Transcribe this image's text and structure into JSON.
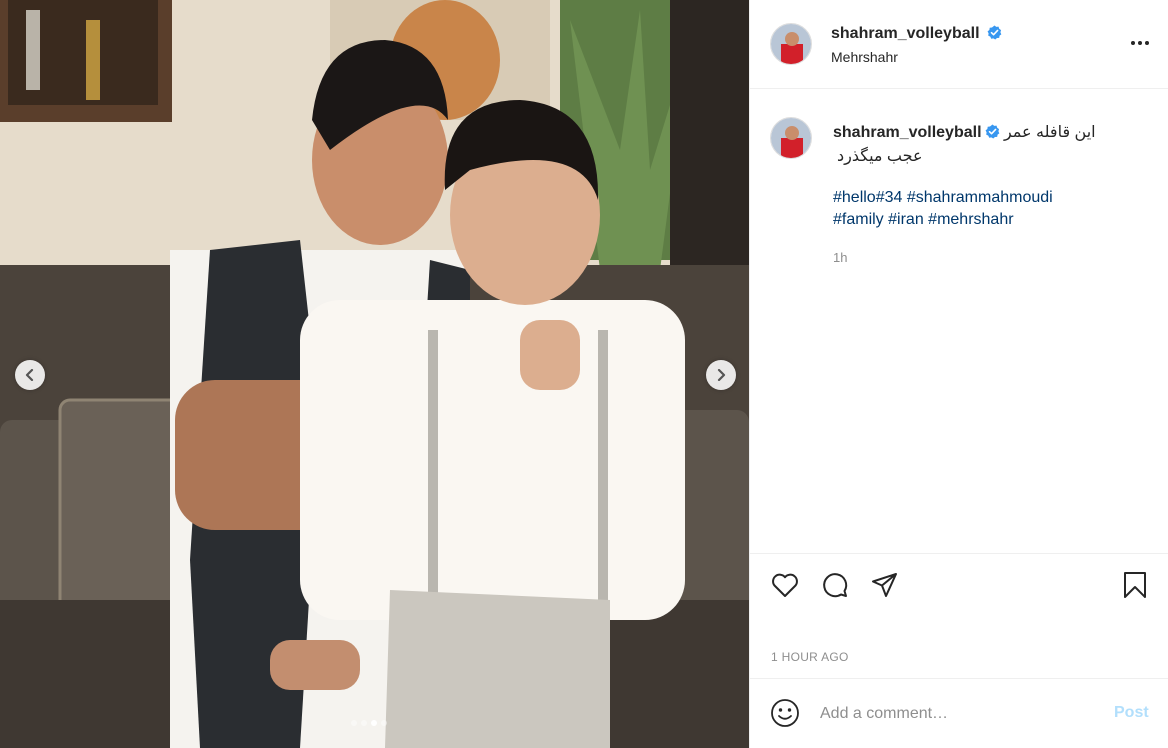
{
  "post": {
    "username": "shahram_volleyball",
    "location": "Mehrshahr",
    "caption_text": "این قافله عمر عجب میگذرد",
    "hashtags": [
      "#hello",
      "#34",
      " #shahrammahmoudi",
      "#family",
      " #iran",
      " #mehrshahr"
    ],
    "relative_time": "1h",
    "timestamp": "1 HOUR AGO"
  },
  "comment": {
    "placeholder": "Add a comment…",
    "post_label": "Post"
  },
  "carousel": {
    "slide_count": 4,
    "active_index": 2
  },
  "colors": {
    "verified": "#3897f0",
    "hashtag": "#00376b",
    "post_disabled": "#b2dffc",
    "muted": "#8e8e8e"
  },
  "icons": {
    "like": "heart-icon",
    "comment": "comment-icon",
    "share": "paper-plane-icon",
    "save": "bookmark-icon",
    "emoji": "smiley-icon",
    "more": "more-options-icon",
    "prev": "chevron-left-icon",
    "next": "chevron-right-icon"
  }
}
